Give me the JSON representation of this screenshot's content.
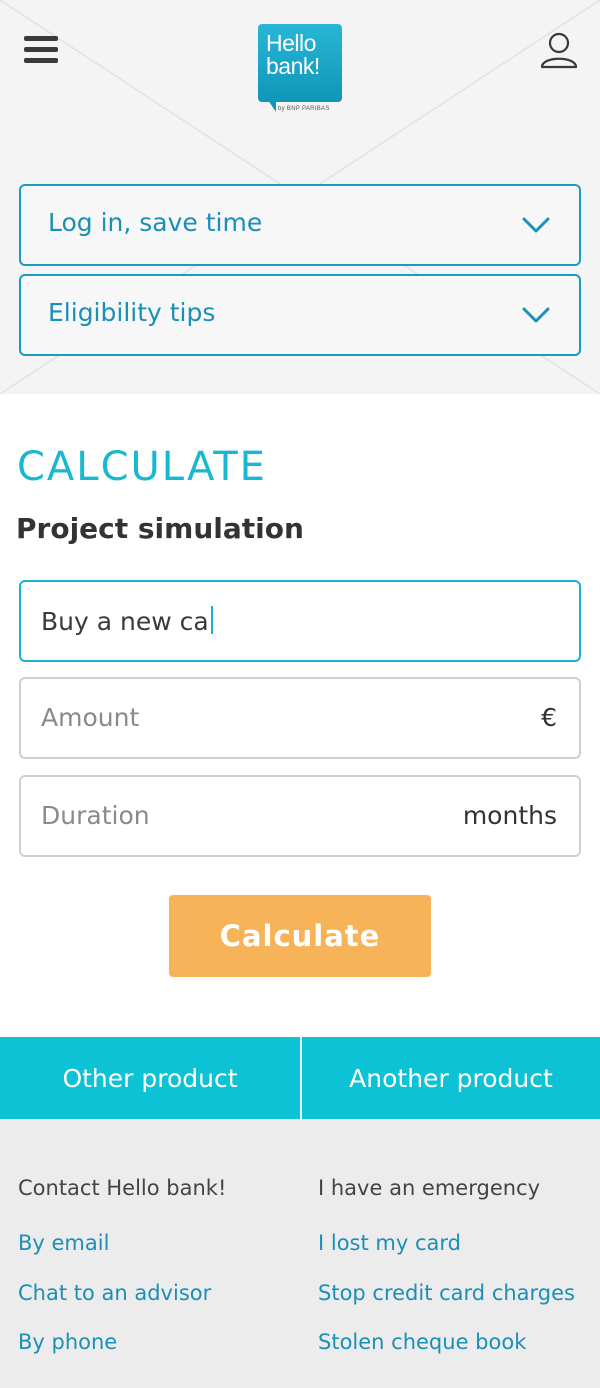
{
  "header": {
    "logo_line1": "Hello",
    "logo_line2": "bank!",
    "logo_by": "by BNP PARIBAS"
  },
  "accordions": [
    {
      "label": "Log in, save time"
    },
    {
      "label": "Eligibility tips"
    }
  ],
  "calculate": {
    "title": "CALCULATE",
    "subtitle": "Project simulation",
    "project_value": "Buy a new ca",
    "amount_placeholder": "Amount",
    "amount_unit": "€",
    "duration_placeholder": "Duration",
    "duration_unit": "months",
    "button_label": "Calculate"
  },
  "tabs": [
    {
      "label": "Other product"
    },
    {
      "label": "Another product"
    }
  ],
  "footer": {
    "contact": {
      "heading": "Contact Hello bank!",
      "links": [
        "By email",
        "Chat to an advisor",
        "By phone"
      ]
    },
    "emergency": {
      "heading": "I have an emergency",
      "links": [
        "I lost my card",
        "Stop credit card charges",
        "Stolen cheque book"
      ]
    }
  },
  "colors": {
    "brand_teal": "#18b8d2",
    "link_blue": "#1a8fb8",
    "button_orange": "#f7b357"
  }
}
